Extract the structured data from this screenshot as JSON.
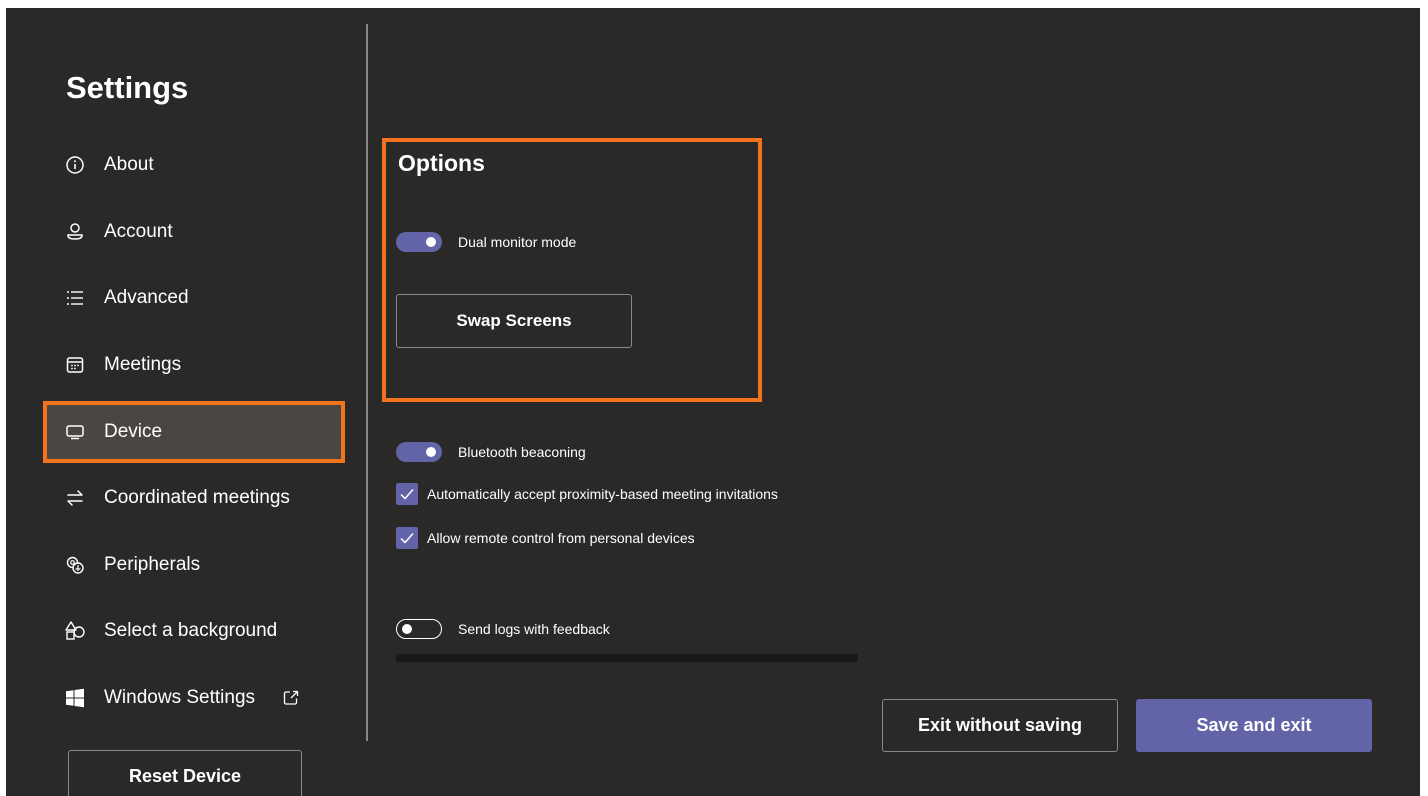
{
  "sidebar": {
    "title": "Settings",
    "items": [
      {
        "label": "About",
        "icon": "info-icon"
      },
      {
        "label": "Account",
        "icon": "person-icon"
      },
      {
        "label": "Advanced",
        "icon": "list-icon"
      },
      {
        "label": "Meetings",
        "icon": "calendar-icon"
      },
      {
        "label": "Device",
        "icon": "monitor-icon",
        "selected": true
      },
      {
        "label": "Coordinated meetings",
        "icon": "swap-arrows-icon"
      },
      {
        "label": "Peripherals",
        "icon": "peripherals-icon"
      },
      {
        "label": "Select a background",
        "icon": "shapes-icon"
      },
      {
        "label": "Windows Settings",
        "icon": "windows-logo-icon",
        "external": "external-link-icon"
      }
    ],
    "reset_label": "Reset Device"
  },
  "main": {
    "options_title": "Options",
    "dual_monitor": {
      "label": "Dual monitor mode",
      "on": true
    },
    "swap_label": "Swap Screens",
    "bluetooth": {
      "label": "Bluetooth beaconing",
      "on": true
    },
    "auto_accept": {
      "label": "Automatically accept proximity-based meeting invitations",
      "checked": true
    },
    "remote_control": {
      "label": "Allow remote control from personal devices",
      "checked": true
    },
    "send_logs": {
      "label": "Send logs with feedback",
      "on": false
    }
  },
  "footer": {
    "exit_label": "Exit without saving",
    "save_label": "Save and exit"
  },
  "colors": {
    "background": "#2a2928",
    "accent": "#6264a7",
    "highlight": "#f5731e"
  }
}
